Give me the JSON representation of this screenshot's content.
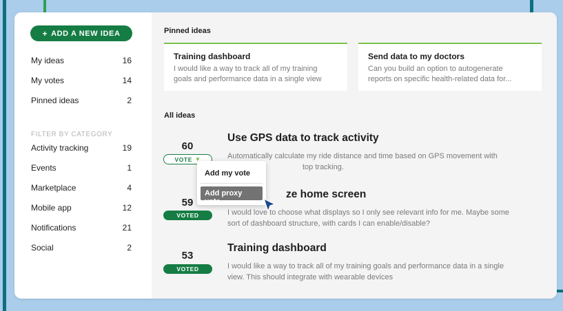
{
  "colors": {
    "background": "#a9cdea",
    "accent_green": "#157d44",
    "pin_border": "#7bc24b",
    "main_bg": "#f4f4f4"
  },
  "sidebar": {
    "add_button_label": "ADD A NEW IDEA",
    "nav": [
      {
        "label": "My ideas",
        "count": "16"
      },
      {
        "label": "My votes",
        "count": "14"
      },
      {
        "label": "Pinned ideas",
        "count": "2"
      }
    ],
    "filter_heading": "FILTER BY CATEGORY",
    "categories": [
      {
        "label": "Activity tracking",
        "count": "19"
      },
      {
        "label": "Events",
        "count": "1"
      },
      {
        "label": "Marketplace",
        "count": "4"
      },
      {
        "label": "Mobile app",
        "count": "12"
      },
      {
        "label": "Notifications",
        "count": "21"
      },
      {
        "label": "Social",
        "count": "2"
      }
    ]
  },
  "main": {
    "pinned_title": "Pinned ideas",
    "pinned": [
      {
        "title": "Training dashboard",
        "desc1": "I would like a way to track all of my training",
        "desc2": "goals and performance data in a single view"
      },
      {
        "title": "Send data to my doctors",
        "desc1": "Can you build an option to autogenerate",
        "desc2": "reports on specific health-related data for..."
      }
    ],
    "all_title": "All ideas",
    "ideas": [
      {
        "count": "60",
        "badge": "VOTE",
        "title": "Use GPS data to track activity",
        "desc1": "Automatically calculate my ride distance and time based on GPS movement with",
        "desc2": "top tracking."
      },
      {
        "count": "59",
        "badge": "VOTED",
        "title": "ze home screen",
        "desc1": "I would love to choose what displays so I only see relevant info for me. Maybe some",
        "desc2": "sort of dashboard structure, with cards I can enable/disable?"
      },
      {
        "count": "53",
        "badge": "VOTED",
        "title": "Training dashboard",
        "desc1": "I would like a way to track all of my training goals and performance data in a single",
        "desc2": "view. This should integrate with wearable devices"
      }
    ],
    "dropdown": {
      "add_vote": "Add my vote",
      "add_proxy": "Add proxy vote"
    }
  }
}
